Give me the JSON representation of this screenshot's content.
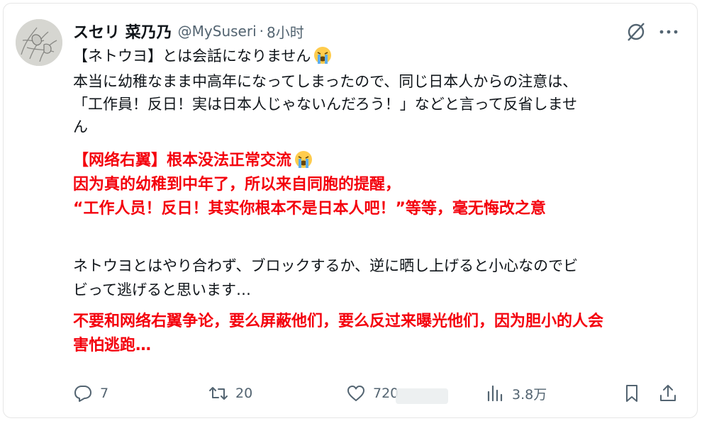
{
  "author": {
    "display_name": "スセリ 菜乃乃",
    "handle": "@MySuseri",
    "separator": "·",
    "time": "8小时"
  },
  "post": {
    "lines": [
      {
        "text": "【ネトウヨ】とは会話になりません",
        "style": "jp",
        "emoji": "loudly-crying-face"
      },
      {
        "text": "本当に幼稚なまま中高年になってしまったので、同じ日本人からの注意は、",
        "style": "jp"
      },
      {
        "text": "「工作員！反日！実は日本人じゃないんだろう！」などと言って反省しませ",
        "style": "jp"
      },
      {
        "text": "ん",
        "style": "jp"
      },
      {
        "text": "【网络右翼】根本没法正常交流",
        "style": "cn",
        "emoji": "loudly-crying-face"
      },
      {
        "text": "因为真的幼稚到中年了，所以来自同胞的提醒，",
        "style": "cn"
      },
      {
        "text": "“工作人员！反日！其实你根本不是日本人吧！”等等，毫无悔改之意",
        "style": "cn"
      },
      {
        "text": "ネトウヨとはやり合わず、ブロックするか、逆に晒し上げると小心なのでビ",
        "style": "jp"
      },
      {
        "text": "ビって逃げると思います…",
        "style": "jp"
      },
      {
        "text": "不要和网络右翼争论，要么屏蔽他们，要么反过来曝光他们，因为胆小的人会",
        "style": "cn"
      },
      {
        "text": "害怕逃跑…",
        "style": "cn"
      }
    ]
  },
  "actions": {
    "replies": {
      "icon": "reply-icon",
      "count": "7"
    },
    "reposts": {
      "icon": "repost-icon",
      "count": "20"
    },
    "likes": {
      "icon": "heart-icon",
      "count": "720"
    },
    "views": {
      "icon": "analytics-icon",
      "count": "3.8万"
    },
    "bookmark": {
      "icon": "bookmark-icon"
    },
    "share": {
      "icon": "share-icon"
    }
  },
  "colors": {
    "translation_red": "#f4000c",
    "muted": "#536471",
    "text": "#0f1419",
    "border": "#e6e6e6"
  }
}
